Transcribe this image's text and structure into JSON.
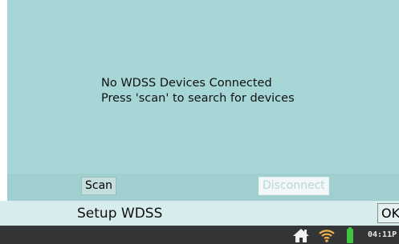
{
  "message": {
    "line1": "No WDSS Devices Connected",
    "line2": "Press 'scan' to search for devices"
  },
  "buttons": {
    "scan_label": "Scan",
    "disconnect_label": "Disconnect"
  },
  "title_bar": {
    "title": "Setup WDSS",
    "ok_label": "OK"
  },
  "status_bar": {
    "icons": [
      "home-icon",
      "wifi-icon",
      "battery-icon"
    ],
    "clock": "04:11P",
    "battery_color": "#3ec43e"
  },
  "colors": {
    "panel_bg": "#a7d6d6",
    "button_row_bg": "#9fcfcf",
    "title_bar_bg": "#d7ecec",
    "status_bar_bg": "#333536"
  }
}
